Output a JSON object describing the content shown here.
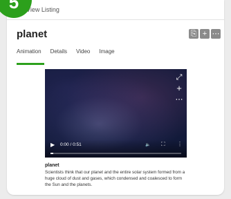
{
  "badge": {
    "text": "5"
  },
  "header": {
    "view_link": "View Listing"
  },
  "title": "planet",
  "tools": [
    {
      "icon": "copy-icon",
      "glyph": "⎘"
    },
    {
      "icon": "plus-icon",
      "glyph": "+"
    },
    {
      "icon": "more-icon",
      "glyph": "⋯"
    }
  ],
  "tabs": [
    "Animation",
    "Details",
    "Video",
    "Image"
  ],
  "active_tab": "Animation",
  "player": {
    "side_icons": [
      {
        "icon": "expand-icon",
        "glyph": "⤢"
      },
      {
        "icon": "add-icon",
        "glyph": "+"
      },
      {
        "icon": "more-icon",
        "glyph": "⋯"
      }
    ],
    "play_glyph": "▶",
    "time": "0:00 / 0:51",
    "volume_glyph": "🔈",
    "fullscreen_glyph": "⛶",
    "menu_glyph": "⋮",
    "progress": 0.02
  },
  "caption": {
    "title": "planet",
    "text": "Scientists think that our planet and the entire solar system formed from a huge cloud of dust and gases, which condensed and coalesced to form the Sun and the planets."
  },
  "colors": {
    "accent": "#2ca01c",
    "tool_bg": "#8b8b8b",
    "player_bg": "#121a3a"
  }
}
